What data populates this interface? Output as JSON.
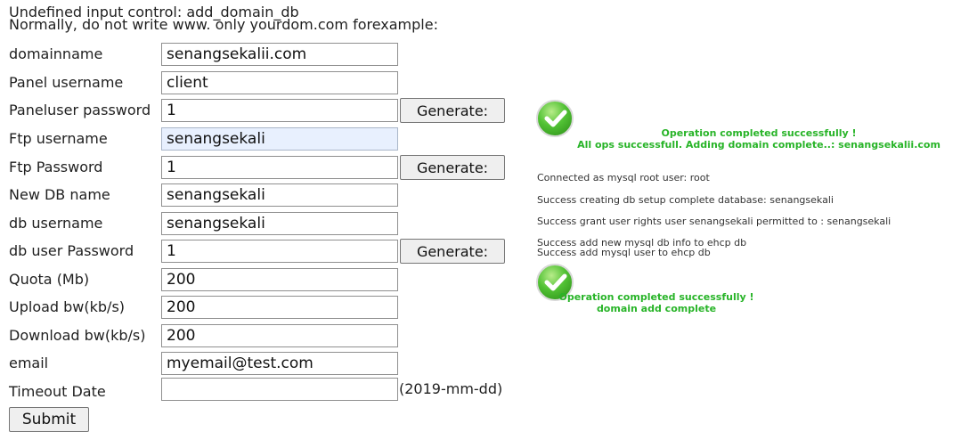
{
  "header": {
    "line1": "Undefined input control: add_domain_db",
    "line2": "Normally, do not write www. only yourdom.com forexample:"
  },
  "form": {
    "rows": [
      {
        "label": "domainname",
        "value": "senangsekalii.com"
      },
      {
        "label": "Panel username",
        "value": "client"
      },
      {
        "label": "Paneluser password",
        "value": "1",
        "button": "Generate:"
      },
      {
        "label": "Ftp username",
        "value": "senangsekali"
      },
      {
        "label": "Ftp Password",
        "value": "1",
        "button": "Generate:"
      },
      {
        "label": "New DB name",
        "value": "senangsekali"
      },
      {
        "label": "db username",
        "value": "senangsekali"
      },
      {
        "label": "db user Password",
        "value": "1",
        "button": "Generate:"
      },
      {
        "label": "Quota (Mb)",
        "value": "200"
      },
      {
        "label": "Upload bw(kb/s)",
        "value": "200"
      },
      {
        "label": "Download bw(kb/s)",
        "value": "200"
      },
      {
        "label": "email",
        "value": "myemail@test.com"
      },
      {
        "label": "Timeout Date",
        "value": "",
        "hint": "(2019-mm-dd)"
      }
    ],
    "submit_label": "Submit"
  },
  "results": {
    "msg1_line1": "Operation completed successfully !",
    "msg1_line2": "All ops successfull. Adding domain complete..: senangsekalii.com",
    "log": [
      "Connected as mysql root user: root",
      "Success creating db setup complete database: senangsekali",
      "Success grant user rights user senangsekali permitted to : senangsekali",
      "Success add new mysql db info to ehcp db",
      "Success add mysql user to ehcp db"
    ],
    "msg2_line1": "Operation completed successfully !",
    "msg2_line2": "domain add complete"
  },
  "colors": {
    "success_text": "#28b428",
    "focused_input_bg": "#e8f0fe"
  }
}
